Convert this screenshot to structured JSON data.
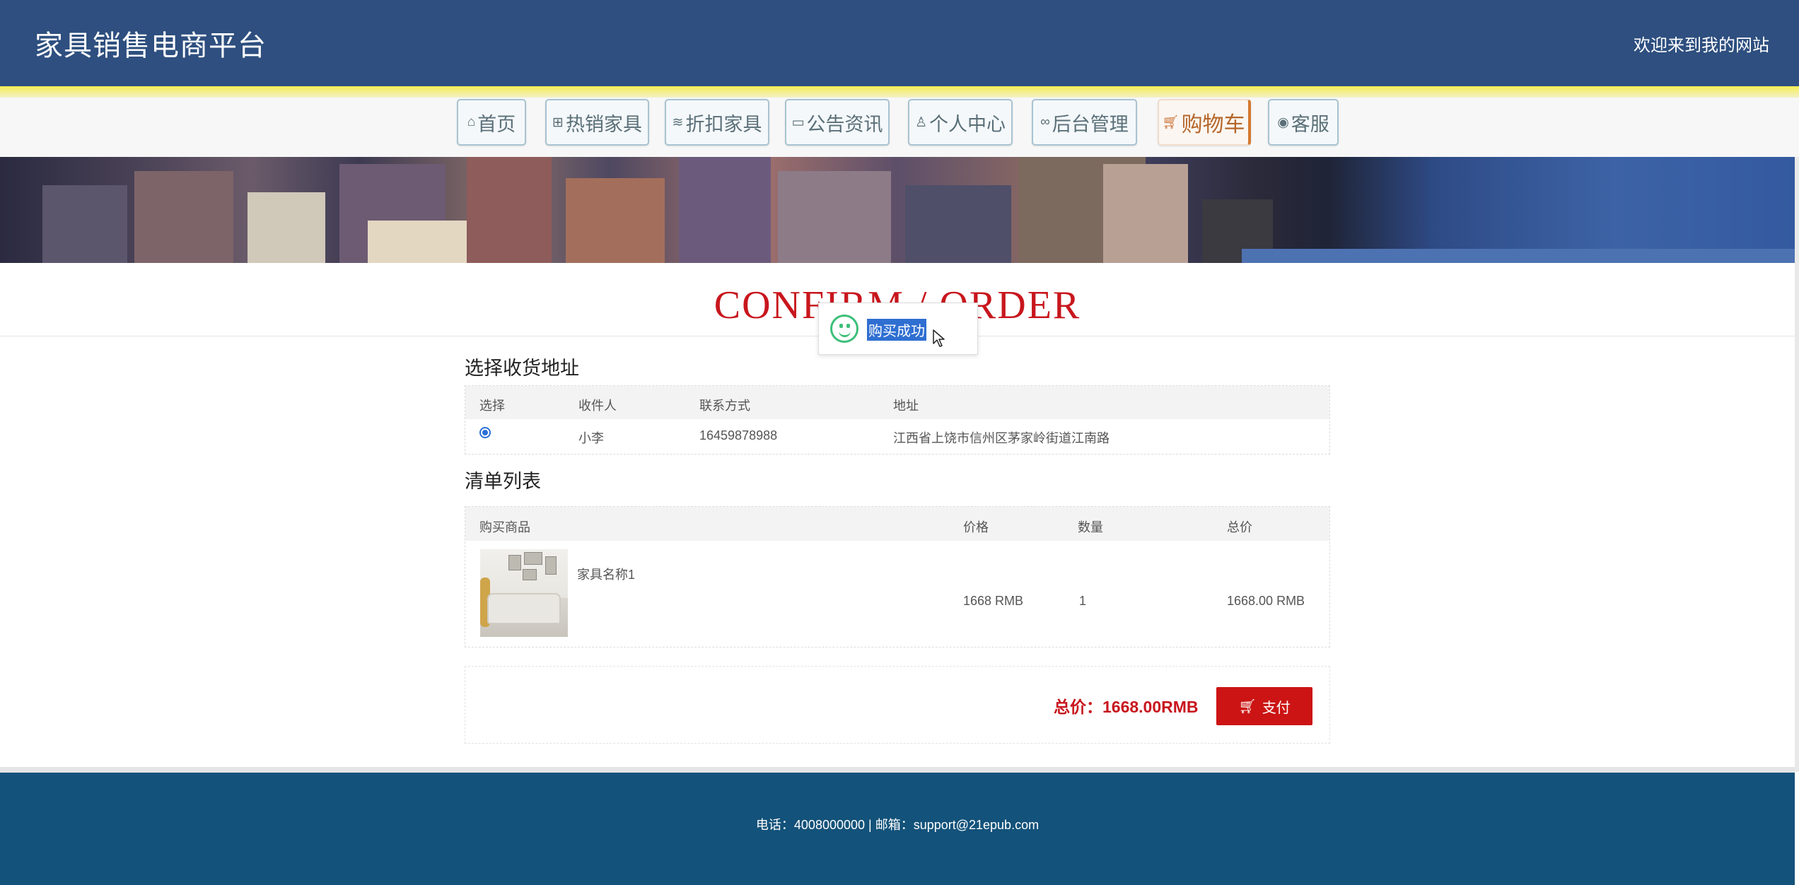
{
  "header": {
    "site_title": "家具销售电商平台",
    "welcome": "欢迎来到我的网站"
  },
  "nav": {
    "items": [
      {
        "label": "首页",
        "icon": "home-icon"
      },
      {
        "label": "热销家具",
        "icon": "grid-icon"
      },
      {
        "label": "折扣家具",
        "icon": "layers-icon"
      },
      {
        "label": "公告资讯",
        "icon": "note-icon"
      },
      {
        "label": "个人中心",
        "icon": "user-icon"
      },
      {
        "label": "后台管理",
        "icon": "link-icon"
      },
      {
        "label": "购物车",
        "icon": "cart-icon",
        "active": true
      },
      {
        "label": "客服",
        "icon": "support-icon"
      }
    ]
  },
  "page": {
    "title": "CONFIRM / ORDER"
  },
  "toast": {
    "message": "购买成功",
    "icon": "smile-icon",
    "color": "#3cbf7a"
  },
  "address": {
    "section_title": "选择收货地址",
    "headers": [
      "选择",
      "收件人",
      "联系方式",
      "地址"
    ],
    "rows": [
      {
        "recipient": "小李",
        "phone": "16459878988",
        "address": "江西省上饶市信州区茅家岭街道江南路",
        "selected": true
      }
    ]
  },
  "cart": {
    "section_title": "清单列表",
    "headers": [
      "购买商品",
      "价格",
      "数量",
      "总价"
    ],
    "rows": [
      {
        "name": "家具名称1",
        "price": "1668 RMB",
        "quantity": "1",
        "total": "1668.00 RMB"
      }
    ]
  },
  "summary": {
    "total_label": "总价：1668.00RMB",
    "pay_label": "支付",
    "accent": "#cc1414"
  },
  "footer": {
    "text": "电话：4008000000 | 邮箱：support@21epub.com"
  }
}
